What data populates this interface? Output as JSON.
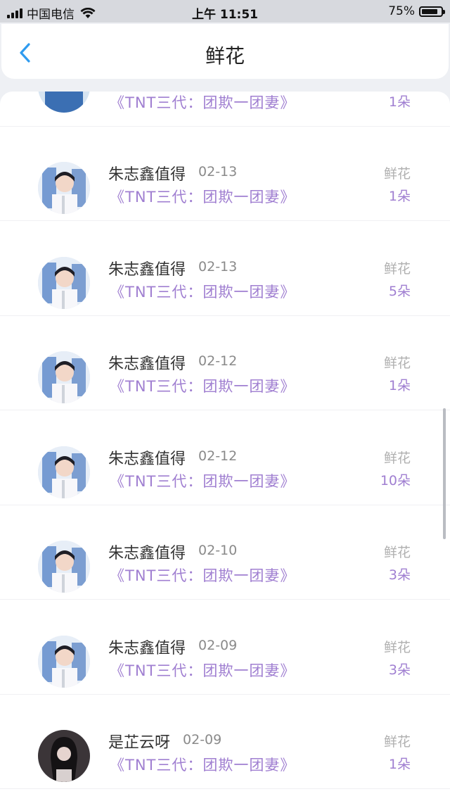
{
  "status_bar": {
    "carrier": "中国电信",
    "time": "上午 11:51",
    "battery": "75%",
    "battery_level": 0.75
  },
  "nav": {
    "title": "鲜花",
    "back_icon": "chevron-left-icon"
  },
  "list": {
    "partial_item": {
      "book": "《TNT三代：团欺一团妻》",
      "count": "1朵"
    },
    "items": [
      {
        "name": "朱志鑫值得",
        "date": "02-13",
        "book": "《TNT三代：团欺一团妻》",
        "gift": "鲜花",
        "count": "1朵",
        "avatar": "photo"
      },
      {
        "name": "朱志鑫值得",
        "date": "02-13",
        "book": "《TNT三代：团欺一团妻》",
        "gift": "鲜花",
        "count": "5朵",
        "avatar": "photo"
      },
      {
        "name": "朱志鑫值得",
        "date": "02-12",
        "book": "《TNT三代：团欺一团妻》",
        "gift": "鲜花",
        "count": "1朵",
        "avatar": "photo"
      },
      {
        "name": "朱志鑫值得",
        "date": "02-12",
        "book": "《TNT三代：团欺一团妻》",
        "gift": "鲜花",
        "count": "10朵",
        "avatar": "photo"
      },
      {
        "name": "朱志鑫值得",
        "date": "02-10",
        "book": "《TNT三代：团欺一团妻》",
        "gift": "鲜花",
        "count": "3朵",
        "avatar": "photo"
      },
      {
        "name": "朱志鑫值得",
        "date": "02-09",
        "book": "《TNT三代：团欺一团妻》",
        "gift": "鲜花",
        "count": "3朵",
        "avatar": "photo"
      },
      {
        "name": "是芷云呀",
        "date": "02-09",
        "book": "《TNT三代：团欺一团妻》",
        "gift": "鲜花",
        "count": "1朵",
        "avatar": "photo-dark"
      }
    ]
  },
  "colors": {
    "accent_purple": "#a07fd1",
    "back_blue": "#2f9bef"
  }
}
